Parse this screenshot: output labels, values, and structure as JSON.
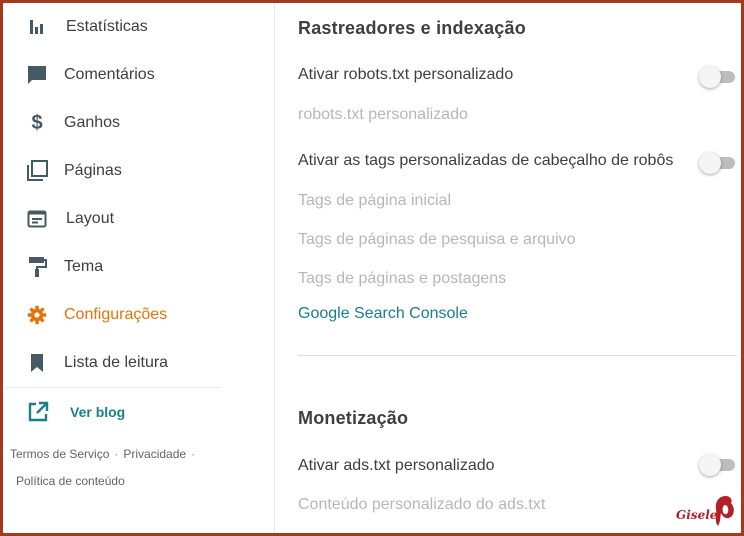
{
  "sidebar": {
    "items": [
      {
        "label": "Estatísticas",
        "icon": "stats-icon",
        "active": false
      },
      {
        "label": "Comentários",
        "icon": "comment-icon",
        "active": false
      },
      {
        "label": "Ganhos",
        "icon": "dollar-icon",
        "active": false
      },
      {
        "label": "Páginas",
        "icon": "pages-icon",
        "active": false
      },
      {
        "label": "Layout",
        "icon": "layout-icon",
        "active": false
      },
      {
        "label": "Tema",
        "icon": "paint-roller-icon",
        "active": false
      },
      {
        "label": "Configurações",
        "icon": "gear-icon",
        "active": true
      },
      {
        "label": "Lista de leitura",
        "icon": "bookmark-icon",
        "active": false
      }
    ],
    "view_blog": "Ver blog",
    "footer": {
      "terms": "Termos de Serviço",
      "privacy": "Privacidade",
      "content_policy": "Política de conteúdo"
    }
  },
  "crawlers": {
    "title": "Rastreadores e indexação",
    "custom_robots_label": "Ativar robots.txt personalizado",
    "custom_robots_on": false,
    "custom_robots_field": "robots.txt personalizado",
    "robot_tags_label": "Ativar as tags personalizadas de cabeçalho de robôs",
    "robot_tags_on": false,
    "home_tags": "Tags de página inicial",
    "archive_tags": "Tags de páginas de pesquisa e arquivo",
    "post_tags": "Tags de páginas e postagens",
    "search_console_link": "Google Search Console"
  },
  "monetization": {
    "title": "Monetização",
    "ads_txt_label": "Ativar ads.txt personalizado",
    "ads_txt_on": false,
    "ads_txt_field": "Conteúdo personalizado do ads.txt"
  },
  "signature": "Gisele",
  "colors": {
    "accent_active": "#e8710a",
    "link": "#1a7f8a",
    "icon": "#455a64",
    "frame": "#a33a1b"
  }
}
